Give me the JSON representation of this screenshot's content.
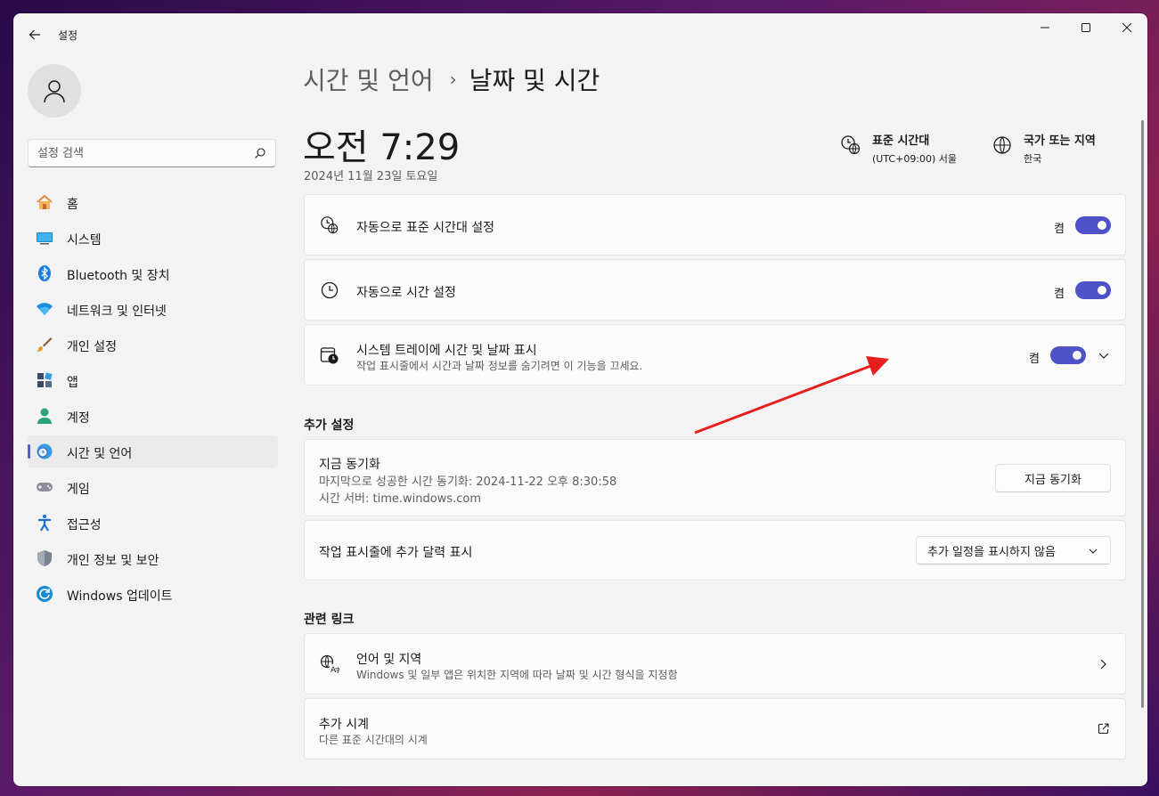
{
  "app": {
    "title": "설정"
  },
  "search": {
    "placeholder": "설정 검색"
  },
  "sidebar": {
    "items": [
      {
        "label": "홈",
        "icon": "home-icon"
      },
      {
        "label": "시스템",
        "icon": "system-icon"
      },
      {
        "label": "Bluetooth 및 장치",
        "icon": "bluetooth-icon"
      },
      {
        "label": "네트워크 및 인터넷",
        "icon": "wifi-icon"
      },
      {
        "label": "개인 설정",
        "icon": "brush-icon"
      },
      {
        "label": "앱",
        "icon": "apps-icon"
      },
      {
        "label": "계정",
        "icon": "account-icon"
      },
      {
        "label": "시간 및 언어",
        "icon": "time-language-icon",
        "active": true
      },
      {
        "label": "게임",
        "icon": "gamepad-icon"
      },
      {
        "label": "접근성",
        "icon": "accessibility-icon"
      },
      {
        "label": "개인 정보 및 보안",
        "icon": "shield-icon"
      },
      {
        "label": "Windows 업데이트",
        "icon": "update-icon"
      }
    ]
  },
  "breadcrumb": {
    "parent": "시간 및 언어",
    "separator": "›",
    "current": "날짜 및 시간"
  },
  "header": {
    "time": "오전 7:29",
    "date": "2024년 11월 23일 토요일",
    "timezone_title": "표준 시간대",
    "timezone_value": "(UTC+09:00) 서울",
    "region_title": "국가 또는 지역",
    "region_value": "한국"
  },
  "settings": {
    "auto_timezone": {
      "title": "자동으로 표준 시간대 설정",
      "state": "켬",
      "on": true
    },
    "auto_time": {
      "title": "자동으로 시간 설정",
      "state": "켬",
      "on": true
    },
    "tray": {
      "title": "시스템 트레이에 시간 및 날짜 표시",
      "subtitle": "작업 표시줄에서 시간과 날짜 정보를 숨기려면 이 기능을 끄세요.",
      "state": "켬",
      "on": true
    }
  },
  "additional": {
    "section_title": "추가 설정",
    "sync": {
      "title": "지금 동기화",
      "last_sync": "마지막으로 성공한 시간 동기화: 2024-11-22 오후 8:30:58",
      "server": "시간 서버: time.windows.com",
      "button": "지금 동기화"
    },
    "calendar": {
      "title": "작업 표시줄에 추가 달력 표시",
      "selected": "추가 일정을 표시하지 않음"
    }
  },
  "related": {
    "section_title": "관련 링크",
    "language": {
      "title": "언어 및 지역",
      "subtitle": "Windows 및 일부 앱은 위치한 지역에 따라 날짜 및 시간 형식을 지정함"
    },
    "clocks": {
      "title": "추가 시계",
      "subtitle": "다른 표준 시간대의 시계"
    }
  },
  "colors": {
    "accent": "#4f51c9",
    "annotation_arrow": "#e81e1e"
  }
}
